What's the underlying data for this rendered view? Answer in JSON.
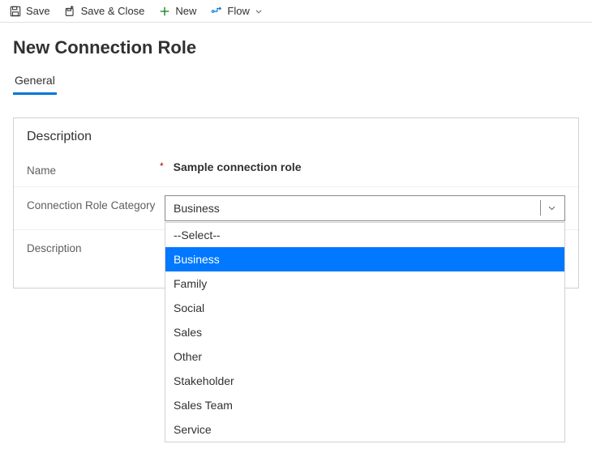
{
  "commandBar": {
    "save": "Save",
    "saveClose": "Save & Close",
    "new": "New",
    "flow": "Flow"
  },
  "page": {
    "title": "New Connection Role",
    "tab": "General"
  },
  "section": {
    "title": "Description",
    "fields": {
      "nameLabel": "Name",
      "nameValue": "Sample connection role",
      "categoryLabel": "Connection Role Category",
      "categorySelected": "Business",
      "descriptionLabel": "Description"
    }
  },
  "dropdown": {
    "options": {
      "o0": "--Select--",
      "o1": "Business",
      "o2": "Family",
      "o3": "Social",
      "o4": "Sales",
      "o5": "Other",
      "o6": "Stakeholder",
      "o7": "Sales Team",
      "o8": "Service"
    }
  }
}
